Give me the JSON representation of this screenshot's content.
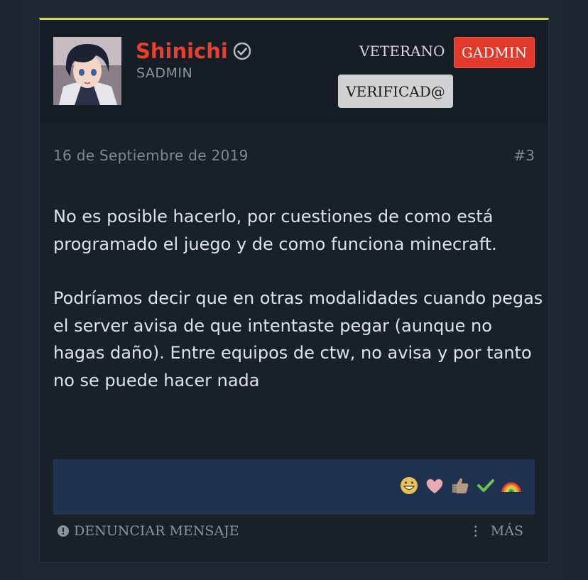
{
  "post": {
    "author": {
      "name": "Shinichi",
      "title": "SADMIN",
      "banner": "VETERANO",
      "badges": [
        "GADMIN",
        "VERIFICAD@"
      ]
    },
    "date": "16 de Septiembre de 2019",
    "number": "#3",
    "body": [
      "No es posible hacerlo, por cuestiones de como está programado el juego y de como funciona minecraft.",
      "Podríamos decir que en otras modalidades cuando pegas el server avisa de que intentaste pegar (aunque no hagas daño). Entre equipos de ctw, no avisa y por tanto no se puede hacer nada"
    ],
    "reactions": [
      "grin-emoji-icon",
      "heart-emoji-icon",
      "thumbs-up-emoji-icon",
      "check-emoji-icon",
      "rainbow-emoji-icon"
    ],
    "actions": {
      "report": "DENUNCIAR MENSAJE",
      "more": "MÁS"
    }
  },
  "colors": {
    "accent_bar": "#c8d84a",
    "username": "#e8402a",
    "gadmin_badge": "#e2392a",
    "verified_badge": "#cfd1d3",
    "reactions_bar": "#1f3350",
    "background": "#1b2431"
  }
}
